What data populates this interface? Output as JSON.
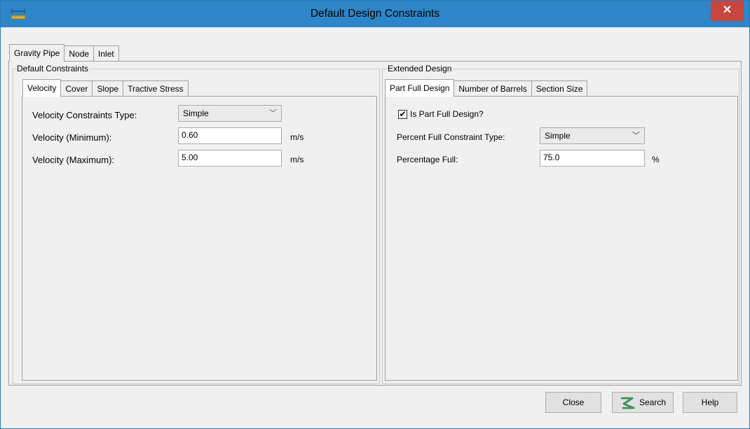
{
  "window": {
    "title": "Default Design Constraints",
    "close_glyph": "✕",
    "icon": "ruler-icon"
  },
  "dialog_tabs": [
    {
      "label": "Gravity Pipe",
      "active": true
    },
    {
      "label": "Node",
      "active": false
    },
    {
      "label": "Inlet",
      "active": false
    }
  ],
  "default_constraints": {
    "group_label": "Default Constraints",
    "tabs": [
      {
        "label": "Velocity",
        "active": true
      },
      {
        "label": "Cover",
        "active": false
      },
      {
        "label": "Slope",
        "active": false
      },
      {
        "label": "Tractive Stress",
        "active": false
      }
    ],
    "constraints_type_label": "Velocity Constraints Type:",
    "constraints_type_value": "Simple",
    "min_label": "Velocity (Minimum):",
    "min_value": "0.60",
    "min_unit": "m/s",
    "max_label": "Velocity (Maximum):",
    "max_value": "5.00",
    "max_unit": "m/s"
  },
  "extended_design": {
    "group_label": "Extended Design",
    "tabs": [
      {
        "label": "Part Full Design",
        "active": true
      },
      {
        "label": "Number of Barrels",
        "active": false
      },
      {
        "label": "Section Size",
        "active": false
      }
    ],
    "is_part_full_label": "Is Part Full Design?",
    "is_part_full_checked": true,
    "check_glyph": "✔",
    "constraint_type_label": "Percent Full Constraint Type:",
    "constraint_type_value": "Simple",
    "percentage_label": "Percentage Full:",
    "percentage_value": "75.0",
    "percentage_unit": "%"
  },
  "buttons": {
    "close": "Close",
    "search": "Search",
    "help": "Help"
  },
  "colors": {
    "titlebar": "#2e86c8",
    "close_button": "#c7463d",
    "dialog_bg": "#f0f0f0"
  }
}
